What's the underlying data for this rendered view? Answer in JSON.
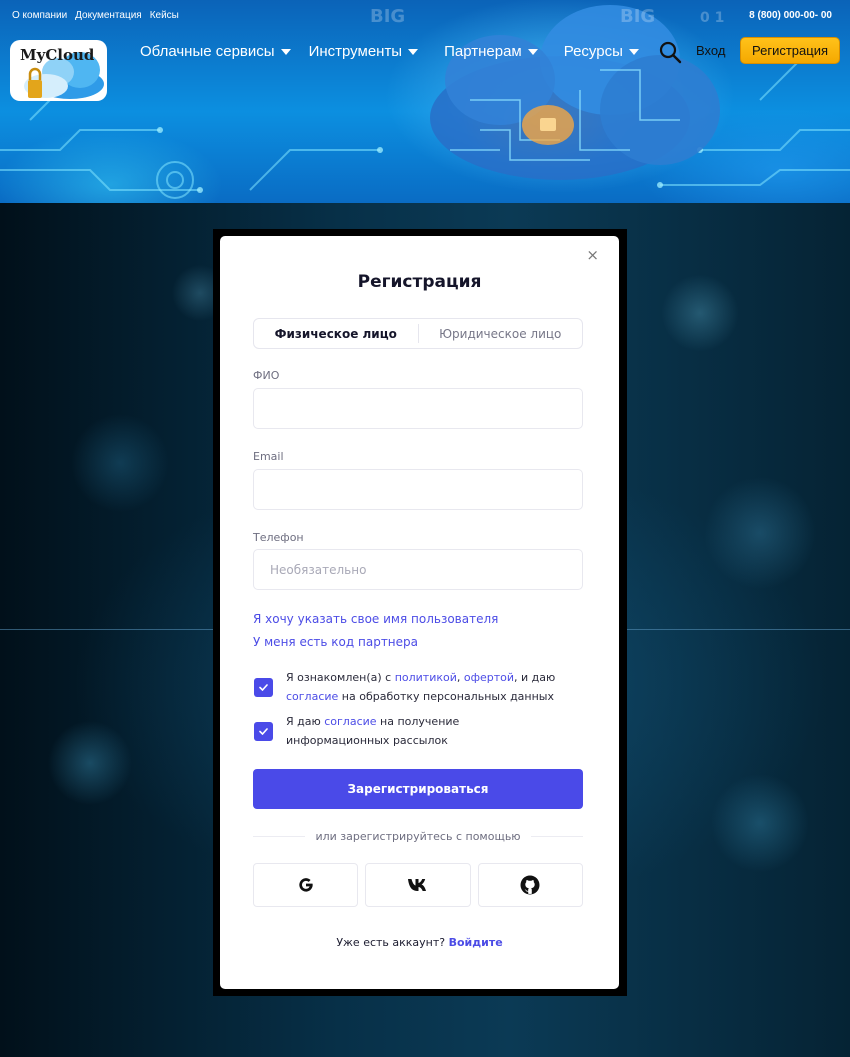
{
  "header": {
    "top_links": [
      "О компании",
      "Документация",
      "Кейсы"
    ],
    "phone": "8 (800) 000-00- 00",
    "logo_text": "MyCloud",
    "nav": [
      {
        "label": "Облачные сервисы"
      },
      {
        "label": "Инструменты"
      },
      {
        "label": "Партнерам"
      },
      {
        "label": "Ресурсы"
      }
    ],
    "login_label": "Вход",
    "register_label": "Регистрация",
    "icons": {
      "search": "search-icon",
      "caret": "caret-down-icon"
    }
  },
  "modal": {
    "title": "Регистрация",
    "close_glyph": "×",
    "tabs": [
      {
        "label": "Физическое лицо",
        "active": true
      },
      {
        "label": "Юридическое лицо",
        "active": false
      }
    ],
    "fields": {
      "fio": {
        "label": "ФИО",
        "value": "",
        "placeholder": ""
      },
      "email": {
        "label": "Email",
        "value": "",
        "placeholder": ""
      },
      "phone": {
        "label": "Телефон",
        "value": "",
        "placeholder": "Необязательно"
      }
    },
    "links": {
      "username": "Я хочу указать свое имя пользователя",
      "partner_code": "У меня есть код партнера"
    },
    "consent": {
      "pre": "Я ознакомлен(а) с ",
      "policy": "политикой",
      "sep": ", ",
      "offer": "офертой",
      "mid": ", и даю ",
      "agreement": "согласие",
      "post": " на обработку персональных данных",
      "checked": true
    },
    "newsletter": {
      "pre": "Я даю ",
      "agreement": "согласие",
      "post": " на получение информационных рассылок",
      "checked": true
    },
    "submit_label": "Зарегистрироваться",
    "or_text": "или зарегистрируйтесь с помощью",
    "social": [
      {
        "name": "google",
        "icon": "google-icon"
      },
      {
        "name": "vk",
        "icon": "vk-icon"
      },
      {
        "name": "github",
        "icon": "github-icon"
      }
    ],
    "footer": {
      "question": "Уже есть аккаунт?",
      "login": "Войдите"
    }
  },
  "colors": {
    "accent": "#4a4ae8",
    "link": "#4c4ce6",
    "register_button": "#f5a800",
    "header_blue": "#0c8fe0"
  }
}
